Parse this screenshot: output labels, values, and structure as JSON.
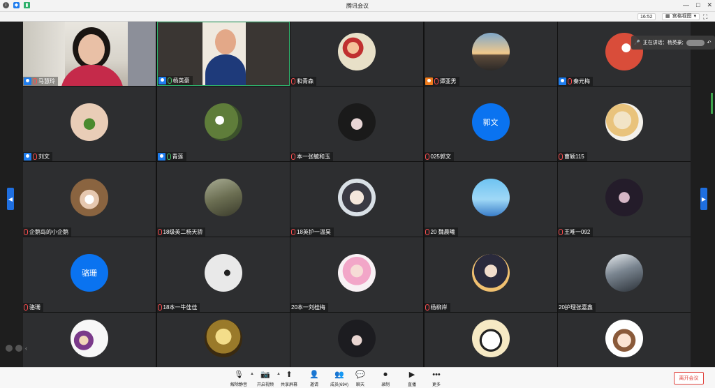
{
  "window": {
    "title": "腾讯会议",
    "min": "—",
    "max": "□",
    "close": "✕"
  },
  "toolbar": {
    "time": "16:52",
    "view_label": "宫格视图",
    "view_caret": "▾",
    "fullscreen": "⛶"
  },
  "speaking": {
    "label": "正在讲话：杨英豪;"
  },
  "colors": {
    "accent": "#1f7dee",
    "leave": "#e0443e",
    "tile_bg": "#2d2e30"
  },
  "participants": [
    {
      "name": "马慧玲",
      "host": true,
      "mic": "off",
      "kind": "video-a"
    },
    {
      "name": "杨英豪",
      "host": true,
      "mic": "on",
      "kind": "video-b"
    },
    {
      "name": "和青森",
      "host": false,
      "mic": "off",
      "kind": "photo",
      "avatar": "family-photo"
    },
    {
      "name": "谭亚男",
      "host": true,
      "host_color": "orange",
      "mic": "off",
      "kind": "photo",
      "avatar": "sunset-photo"
    },
    {
      "name": "秦元梅",
      "host": true,
      "mic": "off",
      "kind": "photo",
      "avatar": "flower-photo"
    },
    {
      "name": "刘文",
      "host": true,
      "mic": "off",
      "kind": "photo",
      "avatar": "hand-clover-photo"
    },
    {
      "name": "青莲",
      "host": true,
      "mic": "on",
      "kind": "photo",
      "avatar": "white-flowers-photo"
    },
    {
      "name": "本一张毓和玉",
      "host": false,
      "mic": "off",
      "kind": "photo",
      "avatar": "cat-ears-girl-photo"
    },
    {
      "name": "025郭文",
      "host": false,
      "mic": "off",
      "kind": "text",
      "initials": "郭文"
    },
    {
      "name": "曹颖115",
      "host": false,
      "mic": "off",
      "kind": "photo",
      "avatar": "anime-boy-photo"
    },
    {
      "name": "企鹅岛的小企鹅",
      "host": false,
      "mic": "off",
      "kind": "photo",
      "avatar": "masked-girl-photo"
    },
    {
      "name": "18级英二杨天骄",
      "host": false,
      "mic": "off",
      "kind": "photo",
      "avatar": "forest-path-photo"
    },
    {
      "name": "18英护一温昊",
      "host": false,
      "mic": "off",
      "kind": "photo",
      "avatar": "anime-man-photo"
    },
    {
      "name": "20 魏晨曦",
      "host": false,
      "mic": "off",
      "kind": "photo",
      "avatar": "blue-sky-photo"
    },
    {
      "name": "王唯一092",
      "host": false,
      "mic": "off",
      "kind": "photo",
      "avatar": "dark-hair-girl-photo"
    },
    {
      "name": "骆珊",
      "host": false,
      "mic": "off",
      "kind": "text",
      "initials": "骆珊"
    },
    {
      "name": "18本一牛佳佳",
      "host": false,
      "mic": "off",
      "kind": "photo",
      "avatar": "ink-painting-photo"
    },
    {
      "name": "20本一刘桂梅",
      "host": false,
      "mic": "none",
      "kind": "photo",
      "avatar": "pink-anime-photo"
    },
    {
      "name": "杨柳岸",
      "host": false,
      "mic": "off",
      "kind": "photo",
      "avatar": "anime-boy-dark-photo"
    },
    {
      "name": "20护理张嘉鑫",
      "host": false,
      "mic": "none",
      "kind": "photo",
      "avatar": "street-person-photo"
    },
    {
      "name": "",
      "host": false,
      "mic": "none",
      "kind": "photo",
      "avatar": "cartoon-kids-photo"
    },
    {
      "name": "",
      "host": false,
      "mic": "none",
      "kind": "photo",
      "avatar": "golden-statue-photo"
    },
    {
      "name": "",
      "host": false,
      "mic": "none",
      "kind": "photo",
      "avatar": "girl-bangs-photo"
    },
    {
      "name": "",
      "host": false,
      "mic": "none",
      "kind": "photo",
      "avatar": "panda-cartoon-photo"
    },
    {
      "name": "",
      "host": false,
      "mic": "none",
      "kind": "photo",
      "avatar": "cute-girl-cartoon-photo"
    }
  ],
  "bottom": {
    "buttons": [
      {
        "label": "解除静音",
        "icon": "mic-off-icon",
        "glyph": "🎙",
        "caret": true
      },
      {
        "label": "开启视频",
        "icon": "camera-off-icon",
        "glyph": "📷",
        "caret": true
      },
      {
        "label": "共享屏幕",
        "icon": "share-screen-icon",
        "glyph": "⬆"
      },
      {
        "label": "邀请",
        "icon": "invite-icon",
        "glyph": "👤"
      },
      {
        "label": "成员(694)",
        "icon": "members-icon",
        "glyph": "👥"
      },
      {
        "label": "聊天",
        "icon": "chat-icon",
        "glyph": "💬"
      },
      {
        "label": "录制",
        "icon": "record-icon",
        "glyph": "⏺"
      },
      {
        "label": "直播",
        "icon": "live-icon",
        "glyph": "▶"
      },
      {
        "label": "更多",
        "icon": "more-icon",
        "glyph": "•••"
      }
    ],
    "leave_label": "离开会议"
  }
}
